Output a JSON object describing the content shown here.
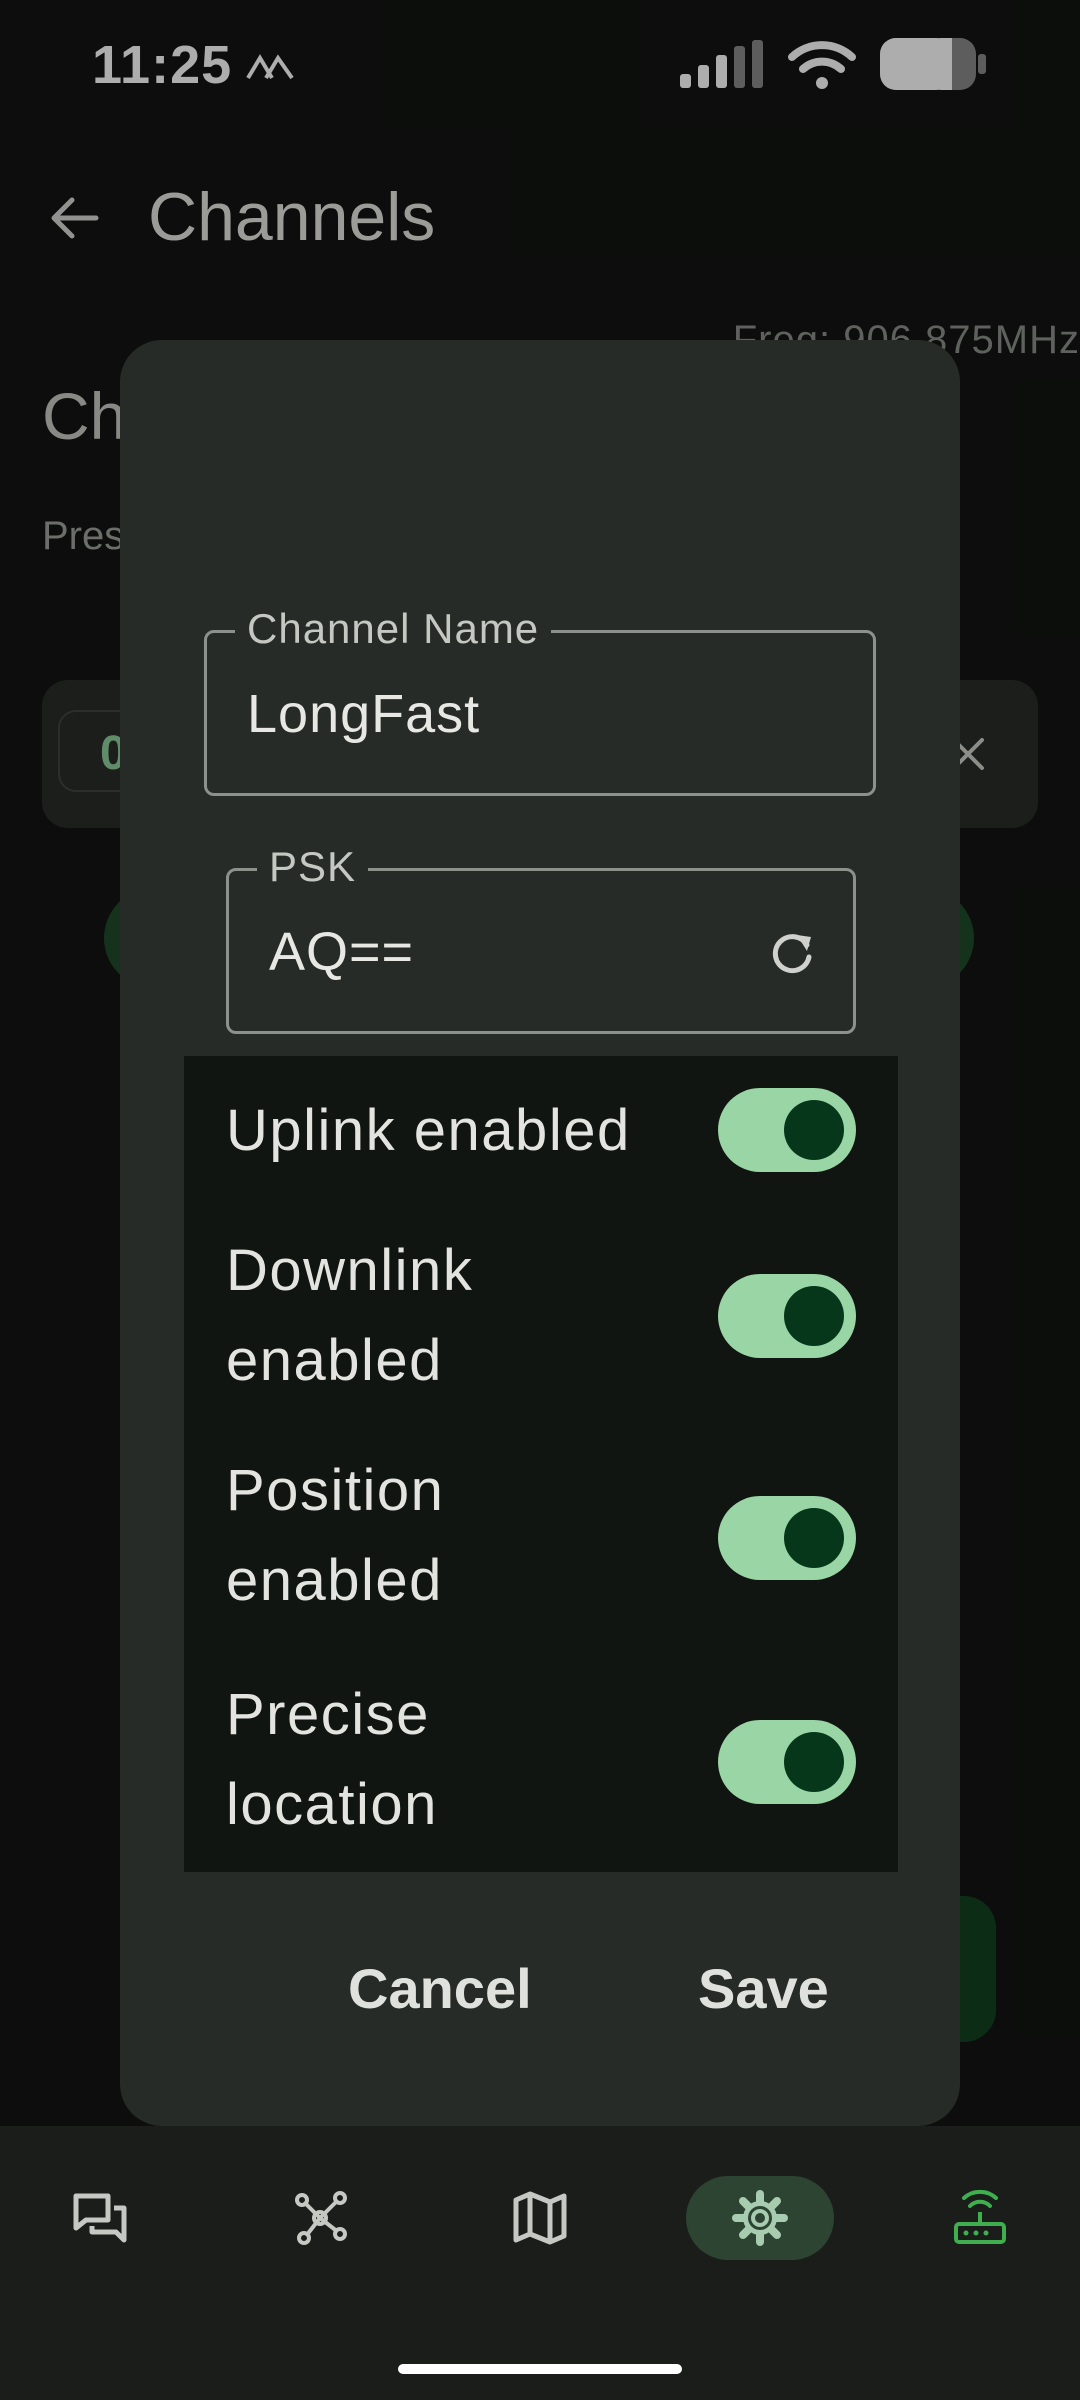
{
  "status_bar": {
    "time": "11:25"
  },
  "app_bar": {
    "title": "Channels"
  },
  "background": {
    "frequency": "Freq: 906.875MHz",
    "heading": "Ch",
    "subheading": "Pres",
    "chip_text": "0"
  },
  "dialog": {
    "channel_name": {
      "label": "Channel Name",
      "value": "LongFast"
    },
    "psk": {
      "label": "PSK",
      "value": "AQ=="
    },
    "switches": [
      {
        "line1": "Uplink enabled",
        "line2": "",
        "on": true
      },
      {
        "line1": "Downlink",
        "line2": "enabled",
        "on": true
      },
      {
        "line1": "Position",
        "line2": "enabled",
        "on": true
      },
      {
        "line1": "Precise",
        "line2": "location",
        "on": true
      }
    ],
    "cancel_label": "Cancel",
    "save_label": "Save"
  },
  "bottom_nav": {
    "items": [
      {
        "icon": "chat-icon"
      },
      {
        "icon": "nodes-icon"
      },
      {
        "icon": "map-icon"
      },
      {
        "icon": "settings-icon",
        "active": true
      },
      {
        "icon": "router-icon"
      }
    ]
  },
  "colors": {
    "accent": "#99d5a5",
    "knob": "#06371a",
    "dialog_bg": "#272b27",
    "router_icon": "#3fae4f"
  }
}
